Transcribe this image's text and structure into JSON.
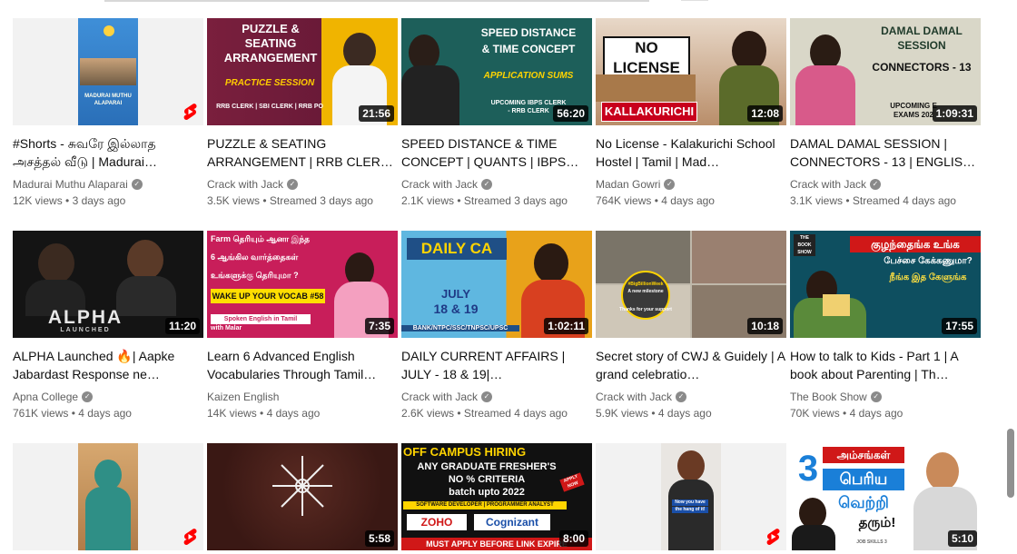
{
  "videos": [
    {
      "title": "#Shorts - சுவரே இல்லாத அசத்தல் வீடு | Madurai…",
      "channel": "Madurai Muthu Alaparai",
      "views": "12K views",
      "age": "3 days ago",
      "duration": "",
      "shorts": true,
      "thumb_texts": [
        "MADURAI MUTHU",
        "ALAPARAI"
      ]
    },
    {
      "title": "PUZZLE & SEATING ARRANGEMENT | RRB CLER…",
      "channel": "Crack with Jack",
      "views": "3.5K views",
      "age": "Streamed 3 days ago",
      "duration": "21:56",
      "shorts": false,
      "thumb_texts": [
        "PUZZLE &",
        "SEATING",
        "ARRANGEMENT",
        "PRACTICE SESSION",
        "RRB CLERK | SBI CLERK | RRB PO"
      ]
    },
    {
      "title": "SPEED DISTANCE & TIME CONCEPT | QUANTS | IBPS…",
      "channel": "Crack with Jack",
      "views": "2.1K views",
      "age": "Streamed 3 days ago",
      "duration": "56:20",
      "shorts": false,
      "thumb_texts": [
        "SPEED DISTANCE",
        "& TIME CONCEPT",
        "APPLICATION SUMS",
        "UPCOMING IBPS CLERK",
        "- RRB CLERK"
      ]
    },
    {
      "title": "No License - Kalakurichi School Hostel | Tamil | Mad…",
      "channel": "Madan Gowri",
      "views": "764K views",
      "age": "4 days ago",
      "duration": "12:08",
      "shorts": false,
      "thumb_texts": [
        "NO LICENSE",
        "KALLAKURICHI"
      ]
    },
    {
      "title": "DAMAL DAMAL SESSION | CONNECTORS - 13 | ENGLIS…",
      "channel": "Crack with Jack",
      "views": "3.1K views",
      "age": "Streamed 4 days ago",
      "duration": "1:09:31",
      "shorts": false,
      "thumb_texts": [
        "DAMAL DAMAL",
        "SESSION",
        "CONNECTORS - 13",
        "UPCOMING E",
        "EXAMS 202"
      ]
    },
    {
      "title": "ALPHA Launched 🔥| Aapke Jabardast Response ne…",
      "channel": "Apna College",
      "views": "761K views",
      "age": "4 days ago",
      "duration": "11:20",
      "shorts": false,
      "thumb_texts": [
        "ALPHA",
        "LAUNCHED"
      ]
    },
    {
      "title": "Learn 6 Advanced English Vocabularies Through Tamil…",
      "channel": "Kaizen English",
      "views": "14K views",
      "age": "4 days ago",
      "duration": "7:35",
      "shorts": false,
      "thumb_texts": [
        "Farm தெரியும் ஆனா இந்த",
        "6 ஆங்கில வார்த்தைகள்",
        "உங்களுக்கு தெரியுமா ?",
        "WAKE UP YOUR VOCAB #58",
        "Spoken English in Tamil",
        "with Malar"
      ]
    },
    {
      "title": "DAILY CURRENT AFFAIRS | JULY - 18 & 19|…",
      "channel": "Crack with Jack",
      "views": "2.6K views",
      "age": "Streamed 4 days ago",
      "duration": "1:02:11",
      "shorts": false,
      "thumb_texts": [
        "DAILY CA",
        "JULY",
        "18 & 19",
        "BANK/NTPC/SSC/TNPSC/UPSC"
      ]
    },
    {
      "title": "Secret story of CWJ & Guidely | A grand celebratio…",
      "channel": "Crack with Jack",
      "views": "5.9K views",
      "age": "4 days ago",
      "duration": "10:18",
      "shorts": false,
      "thumb_texts": [
        "#BigBillionWeek",
        "A new milestone",
        "Thanks for your support"
      ]
    },
    {
      "title": "How to talk to Kids - Part 1 | A book about Parenting | Th…",
      "channel": "The Book Show",
      "views": "70K views",
      "age": "4 days ago",
      "duration": "17:55",
      "shorts": false,
      "thumb_texts": [
        "குழந்தைங்க உங்க",
        "பேச்சை கேக்கணுமா?",
        "நீங்க இத கேளுங்க",
        "THE BOOK SHOW"
      ]
    },
    {
      "title": "",
      "channel": "",
      "views": "",
      "age": "",
      "duration": "",
      "shorts": true,
      "thumb_texts": []
    },
    {
      "title": "",
      "channel": "",
      "views": "",
      "age": "",
      "duration": "5:58",
      "shorts": false,
      "thumb_texts": []
    },
    {
      "title": "",
      "channel": "",
      "views": "",
      "age": "",
      "duration": "8:00",
      "shorts": false,
      "thumb_texts": [
        "OFF CAMPUS HIRING",
        "ANY GRADUATE FRESHER'S",
        "NO % CRITERIA",
        "batch upto 2022",
        "SOFTWARE DEVELOPER | PROGRAMMER ANALYST",
        "ZOHO",
        "Cognizant",
        "MUST APPLY BEFORE LINK EXPIRE",
        "APPLY NOW"
      ]
    },
    {
      "title": "",
      "channel": "",
      "views": "",
      "age": "",
      "duration": "",
      "shorts": true,
      "thumb_texts": [
        "Now you have",
        "the hang of it!"
      ]
    },
    {
      "title": "",
      "channel": "",
      "views": "",
      "age": "",
      "duration": "5:10",
      "shorts": false,
      "thumb_texts": [
        "3",
        "அம்சங்கள்",
        "பெரிய",
        "வெற்றி",
        "தரும்!",
        "JOB SKILLS 3"
      ]
    }
  ],
  "colors": {
    "shorts_red": "#ff0000",
    "duration_bg": "#000000",
    "text_primary": "#0f0f0f",
    "text_secondary": "#606060"
  },
  "icons": {
    "verified": "verified-check-icon",
    "shorts": "shorts-icon"
  }
}
